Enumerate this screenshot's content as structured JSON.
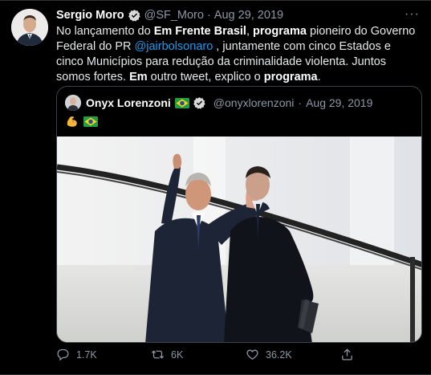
{
  "tweet": {
    "author_name": "Sergio Moro",
    "author_handle": "@SF_Moro",
    "separator": "·",
    "date": "Aug 29, 2019",
    "more": "···",
    "text": {
      "p1": "No lançamento do ",
      "b1": "Em Frente Brasil",
      "p2": ", ",
      "b2": "programa",
      "p3": " pioneiro do Governo Federal do PR ",
      "mention": "@jairbolsonaro",
      "p4": " , juntamente com cinco Estados e cinco Municípios para redução da criminalidade violenta.  Juntos somos fortes. ",
      "b3": "Em",
      "p5": " outro tweet, explico o ",
      "b4": "programa",
      "p6": "."
    }
  },
  "quote": {
    "author_name": "Onyx Lorenzoni",
    "author_handle": "@onyxlorenzoni",
    "separator": "·",
    "date": "Aug 29, 2019"
  },
  "actions": {
    "reply_count": "1.7K",
    "retweet_count": "6K",
    "like_count": "36.2K"
  },
  "colors": {
    "background": "#000000",
    "link": "#1d9bf0",
    "secondary_text": "#8b98a5",
    "verified_badge": "#d9d9d9"
  },
  "icons": [
    "verified-icon",
    "brazil-flag-icon",
    "flexed-biceps-icon",
    "reply-icon",
    "retweet-icon",
    "like-icon",
    "share-icon",
    "more-icon"
  ]
}
